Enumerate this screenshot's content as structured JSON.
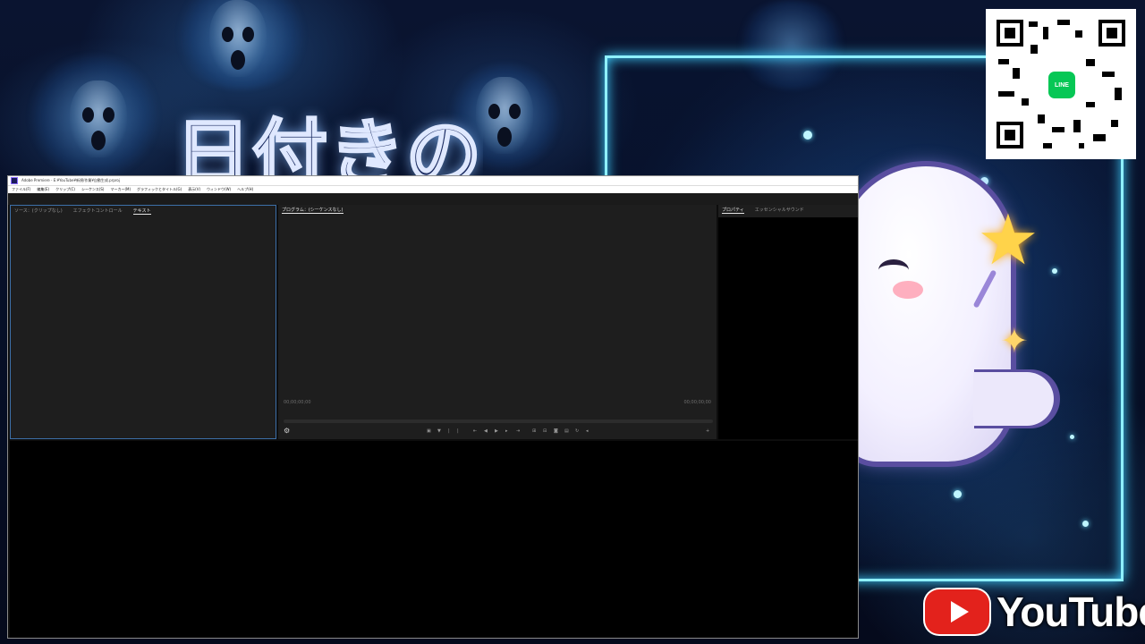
{
  "background": {
    "title_text": "日付きの",
    "qr": {
      "logo_text": "LINE"
    },
    "youtube": {
      "wordmark": "YouTube"
    }
  },
  "window": {
    "title": "Adobe Premiere - E:¥YouTube¥新規/作業¥自動生成.prproj",
    "menu": [
      "ファイル(F)",
      "編集(E)",
      "クリップ(C)",
      "シーケンス(S)",
      "マーカー(M)",
      "グラフィックとタイトル(G)",
      "表示(V)",
      "ウィンドウ(W)",
      "ヘルプ(H)"
    ],
    "source_panel": {
      "tabs": [
        "ソース：(クリップなし)",
        "エフェクトコントロール",
        "テキスト"
      ]
    },
    "program_panel": {
      "tab": "プログラム：(シーケンスなし)",
      "timecode_left": "00;00;00;00",
      "timecode_right": "00;00;00;00"
    },
    "props_panel": {
      "tabs": [
        "プロパティ",
        "エッセンシャルサウンド"
      ]
    }
  },
  "colors": {
    "panel_bg": "#1e1e1e",
    "focus_border": "#3c6fa8",
    "neon": "#8ff0ff",
    "youtube_red": "#e3221c",
    "line_green": "#06c755"
  }
}
